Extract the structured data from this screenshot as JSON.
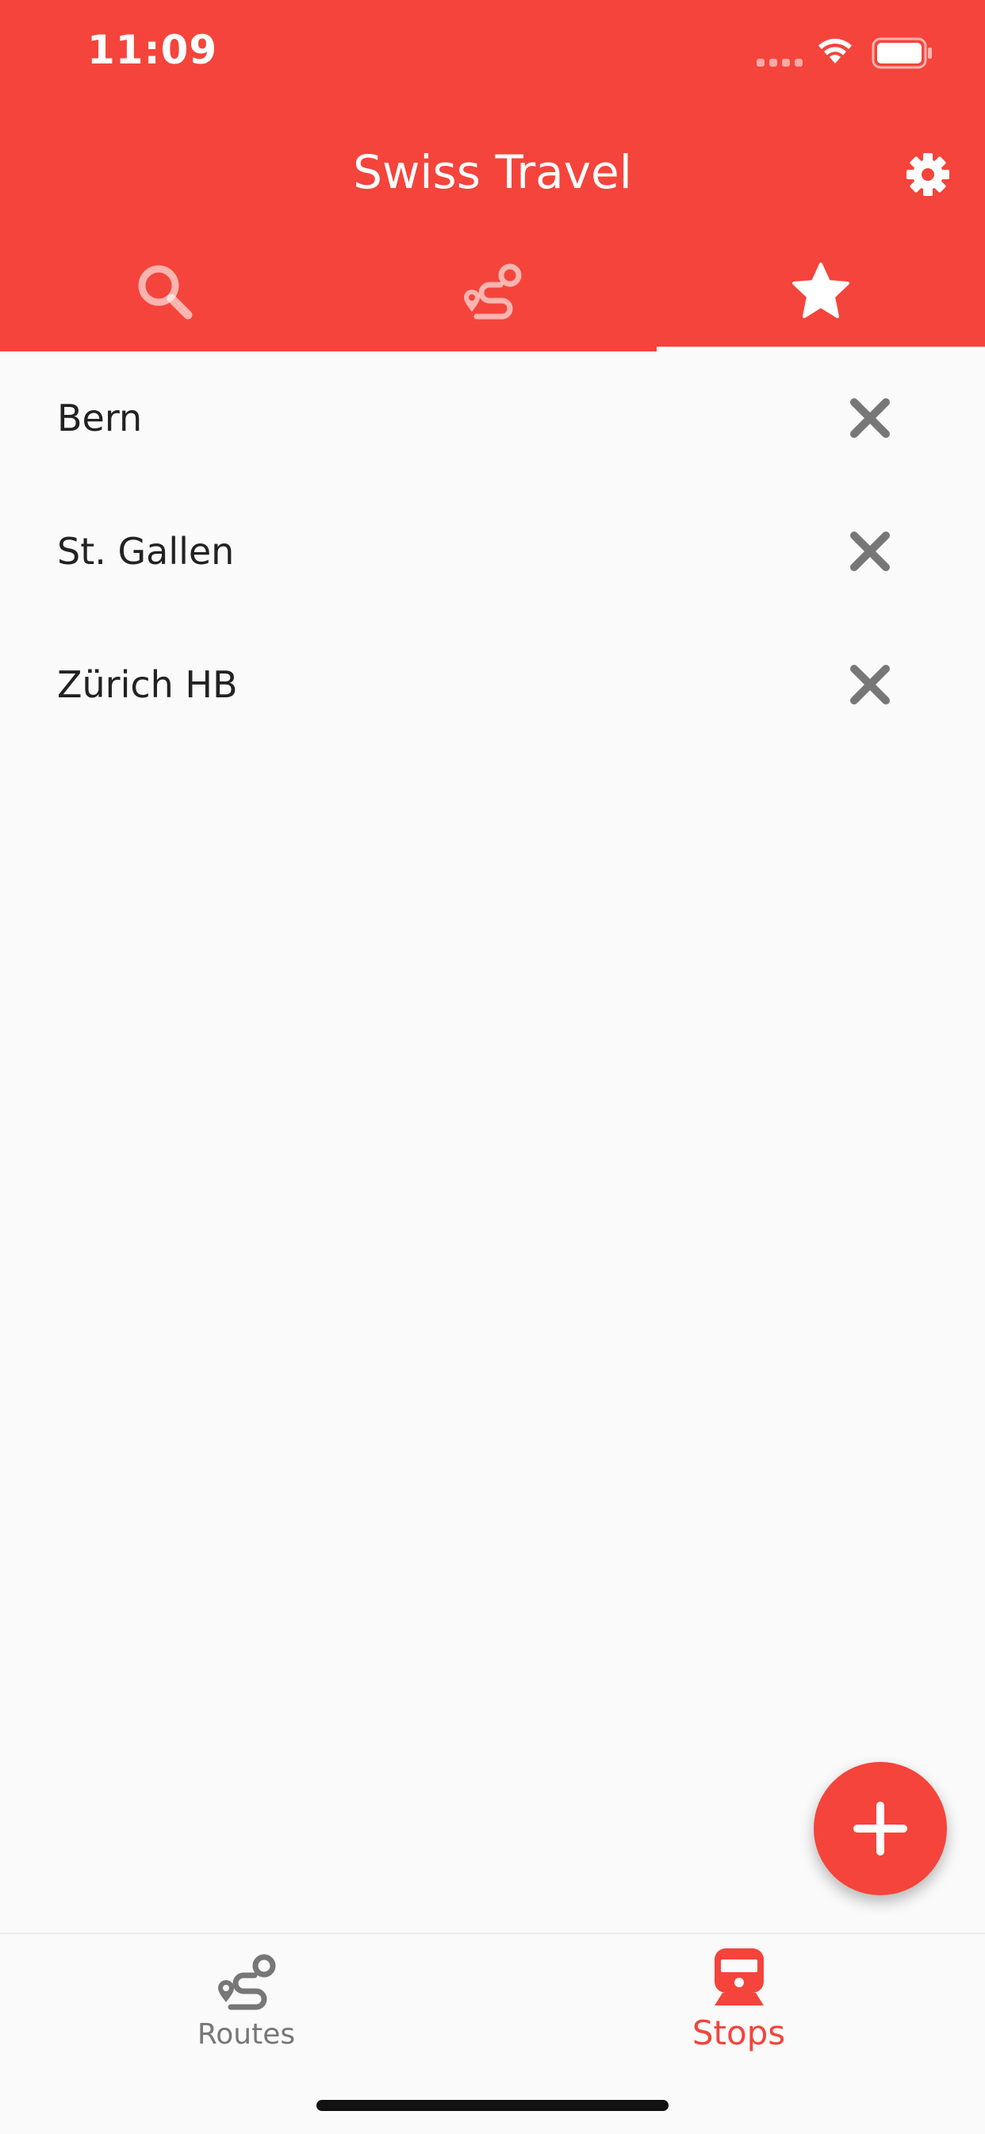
{
  "status_bar": {
    "time": "11:09"
  },
  "header": {
    "title": "Swiss Travel"
  },
  "tabs": [
    {
      "icon": "search-icon",
      "active": false
    },
    {
      "icon": "route-icon",
      "active": false
    },
    {
      "icon": "star-icon",
      "active": true
    }
  ],
  "favorites": [
    {
      "label": "Bern"
    },
    {
      "label": "St. Gallen"
    },
    {
      "label": "Zürich HB"
    }
  ],
  "bottom_nav": {
    "items": [
      {
        "label": "Routes",
        "icon": "route-icon",
        "active": false
      },
      {
        "label": "Stops",
        "icon": "train-icon",
        "active": true
      }
    ]
  },
  "colors": {
    "primary": "#f5443b",
    "background": "#fafafa",
    "inactive": "#777777",
    "text": "#222222"
  }
}
